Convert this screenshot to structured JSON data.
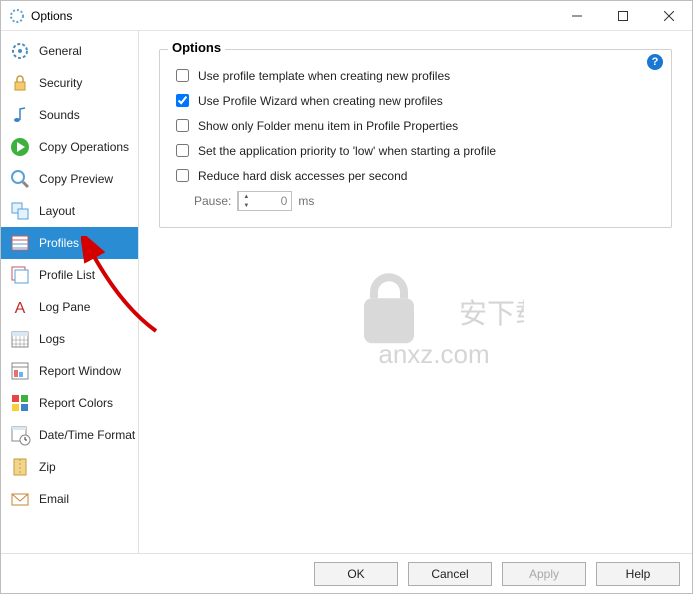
{
  "window": {
    "title": "Options"
  },
  "sidebar": {
    "items": [
      {
        "label": "General"
      },
      {
        "label": "Security"
      },
      {
        "label": "Sounds"
      },
      {
        "label": "Copy Operations"
      },
      {
        "label": "Copy Preview"
      },
      {
        "label": "Layout"
      },
      {
        "label": "Profiles"
      },
      {
        "label": "Profile List"
      },
      {
        "label": "Log Pane"
      },
      {
        "label": "Logs"
      },
      {
        "label": "Report Window"
      },
      {
        "label": "Report Colors"
      },
      {
        "label": "Date/Time Format"
      },
      {
        "label": "Zip"
      },
      {
        "label": "Email"
      }
    ]
  },
  "panel": {
    "title": "Options",
    "check1": "Use profile template when creating new profiles",
    "check2": "Use Profile Wizard when creating new profiles",
    "check3": "Show only Folder menu item in Profile Properties",
    "check4": "Set the application priority to 'low' when starting a profile",
    "check5": "Reduce hard disk accesses per second",
    "pauseLabel": "Pause:",
    "pauseValue": "0",
    "pauseUnit": "ms",
    "help": "?"
  },
  "footer": {
    "ok": "OK",
    "cancel": "Cancel",
    "apply": "Apply",
    "help": "Help"
  },
  "watermark": {
    "line1": "安下载",
    "line2": "anxz.com"
  }
}
